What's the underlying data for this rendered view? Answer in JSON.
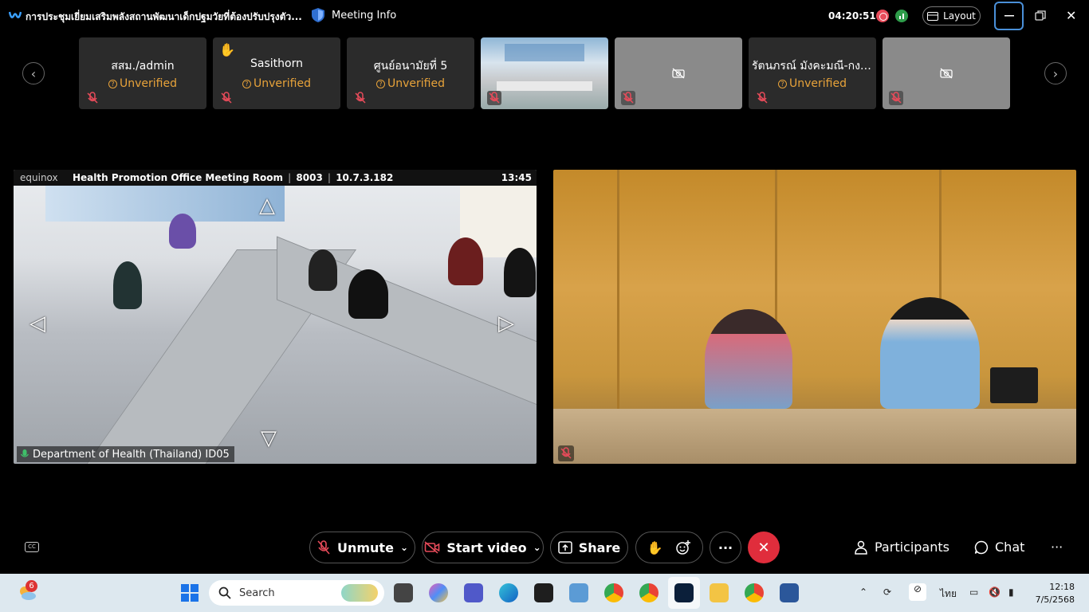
{
  "titlebar": {
    "meeting_title": "การประชุมเยี่ยมเสริมพลังสถานพัฒนาเด็กปฐมวัยที่ต้องปรับปรุงตัว...",
    "meeting_info": "Meeting Info",
    "elapsed_time": "04:20:51",
    "layout_label": "Layout"
  },
  "filmstrip": {
    "participants": [
      {
        "name": "สสม./admin",
        "status": "Unverified"
      },
      {
        "name": "Sasithorn",
        "status": "Unverified",
        "hand_raised": true
      },
      {
        "name": "ศูนย์อนามัยที่ 5",
        "status": "Unverified"
      },
      {
        "name": "",
        "video": true
      },
      {
        "name": "",
        "camera_off": true
      },
      {
        "name": "รัตนภรณ์ มังคะมณี-กง....",
        "status": "Unverified"
      },
      {
        "name": "",
        "camera_off": true
      }
    ]
  },
  "main_video_1": {
    "brand": "equinox",
    "room": "Health Promotion Office Meeting Room",
    "room_id": "8003",
    "ip": "10.7.3.182",
    "time": "13:45",
    "participant_label": "Department of Health (Thailand) ID05"
  },
  "toolbar": {
    "unmute": "Unmute",
    "start_video": "Start video",
    "share": "Share",
    "more": "···",
    "participants": "Participants",
    "chat": "Chat",
    "cc": "CC"
  },
  "taskbar": {
    "weather_badge": "6",
    "search_placeholder": "Search",
    "language": "ไทย",
    "clock_time": "12:18",
    "clock_date": "7/5/2568"
  },
  "colors": {
    "unverified": "#e8a33a",
    "leave_button": "#e02d3c",
    "accent_blue": "#4a90d9"
  }
}
